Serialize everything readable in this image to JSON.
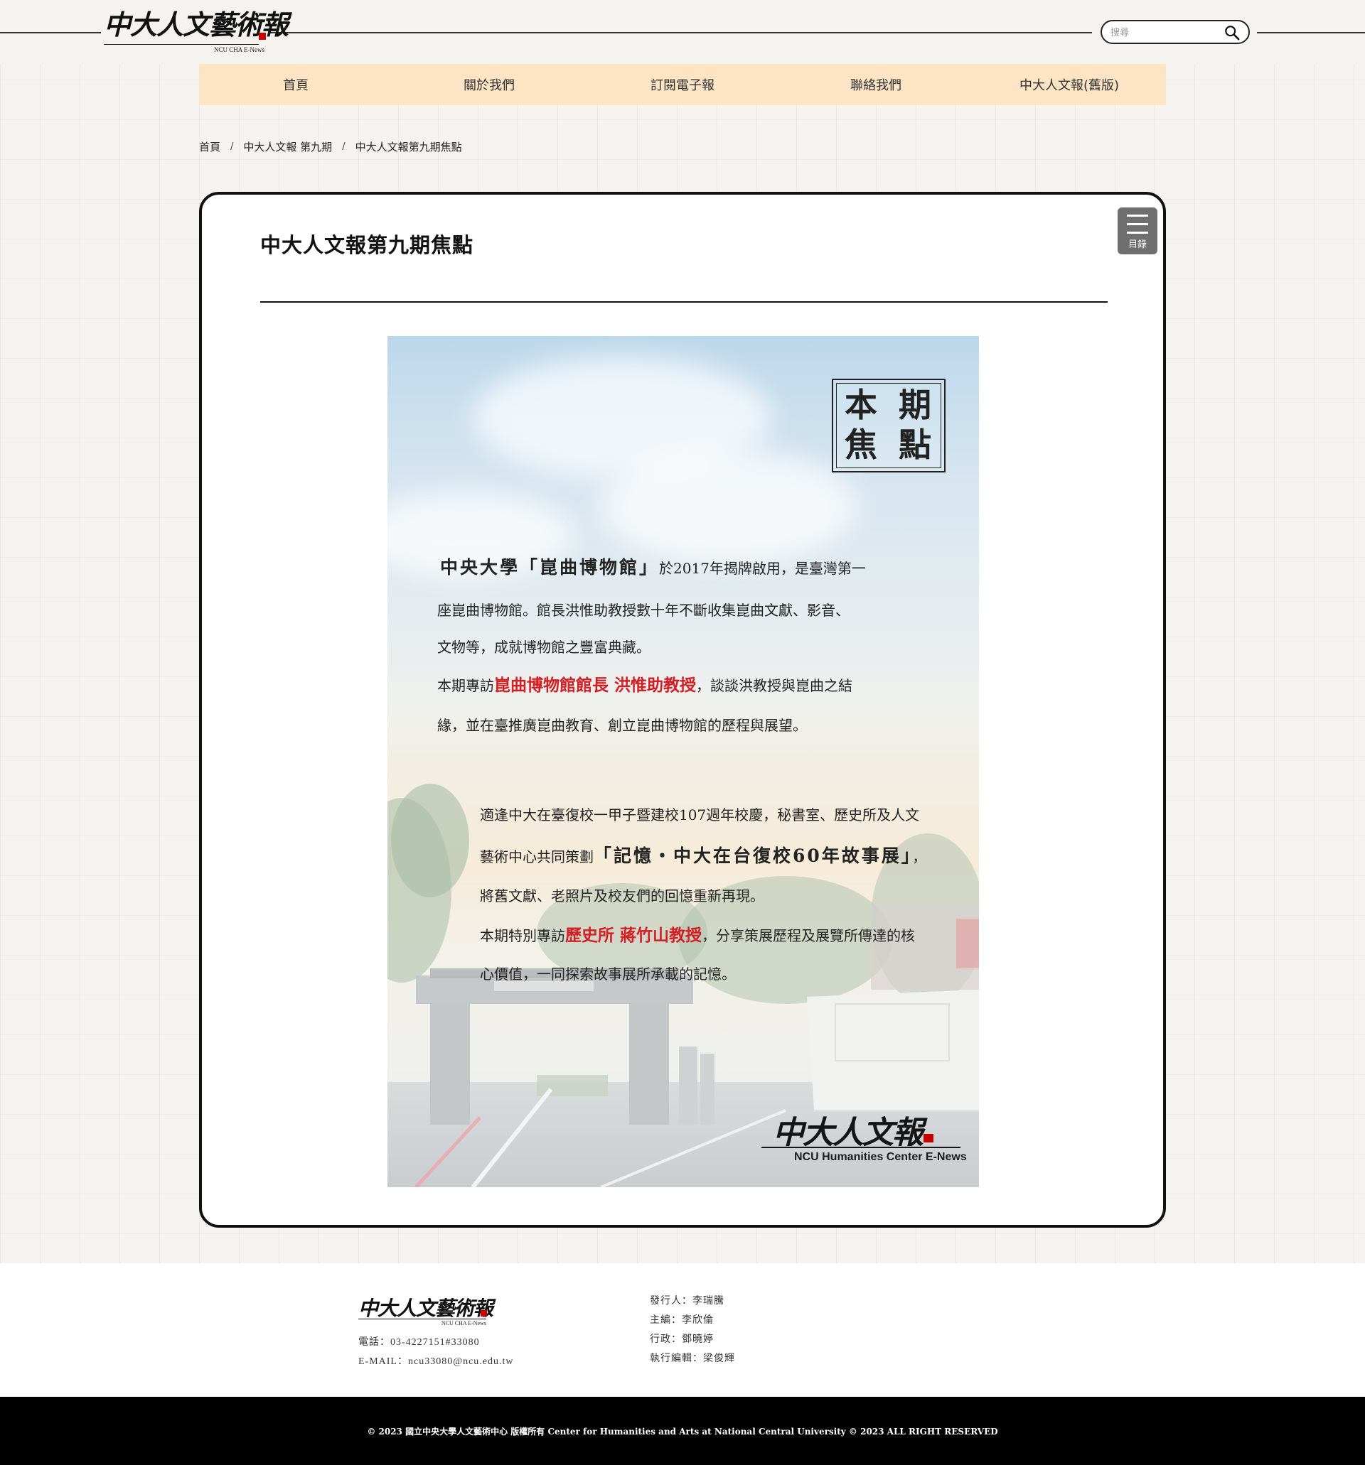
{
  "header": {
    "logo_title": "中大人文藝術報",
    "logo_sub": "NCU CHA E-News",
    "search_placeholder": "搜尋"
  },
  "nav": {
    "items": [
      "首頁",
      "關於我們",
      "訂閱電子報",
      "聯絡我們",
      "中大人文報(舊版)"
    ]
  },
  "breadcrumb": [
    "首頁",
    "中大人文報 第九期",
    "中大人文報第九期焦點"
  ],
  "breadcrumb_separator": "/",
  "article": {
    "title": "中大人文報第九期焦點",
    "menu_label": "目錄"
  },
  "poster": {
    "focus_chars": [
      "本",
      "期",
      "焦",
      "點"
    ],
    "p1_bold": "中央大學「崑曲博物館」",
    "p1_rest": "於2017年揭牌啟用，是臺灣第一",
    "p1_line2": "座崑曲博物館。館長洪惟助教授數十年不斷收集崑曲文獻、影音、",
    "p1_line3": "文物等，成就博物館之豐富典藏。",
    "p2_a": "本期專訪",
    "p2_red": "崑曲博物館館長  洪惟助教授",
    "p2_b": "，談談洪教授與崑曲之結",
    "p2_line2": "緣，並在臺推廣崑曲教育、創立崑曲博物館的歷程與展望。",
    "p3_line1": "適逢中大在臺復校一甲子暨建校107週年校慶，秘書室、歷史所及人文",
    "p3_line2_a": "藝術中心共同策劃",
    "p3_line2_bold": "「記憶・中大在台復校60年故事展」",
    "p3_line2_b": "，",
    "p3_line3": "將舊文獻、老照片及校友們的回憶重新再現。",
    "p4_a": "本期特別專訪",
    "p4_red": "歷史所  蔣竹山教授",
    "p4_b": "，分享策展歷程及展覽所傳達的核",
    "p4_line2": "心價值，一同探索故事展所承載的記憶。",
    "logo_title": "中大人文報",
    "logo_sub": "NCU Humanities Center E-News"
  },
  "footer": {
    "logo_title": "中大人文藝術報",
    "logo_sub": "NCU CHA E-News",
    "phone": "電話：03-4227151#33080",
    "email": "E-MAIL：ncu33080@ncu.edu.tw",
    "staff": [
      "發行人：李瑞騰",
      "主編：李欣倫",
      "行政：鄧曉婷",
      "執行編輯：梁俊輝"
    ],
    "copyright": "© 2023 國立中央大學人文藝術中心 版權所有 Center for Humanities and Arts at National Central University © 2023 ALL RIGHT RESERVED"
  },
  "colors": {
    "nav_bg": "#fde4c4",
    "accent_red": "#d31f24",
    "menu_btn_bg": "#6f6f6f",
    "footer_bar": "#000000"
  }
}
